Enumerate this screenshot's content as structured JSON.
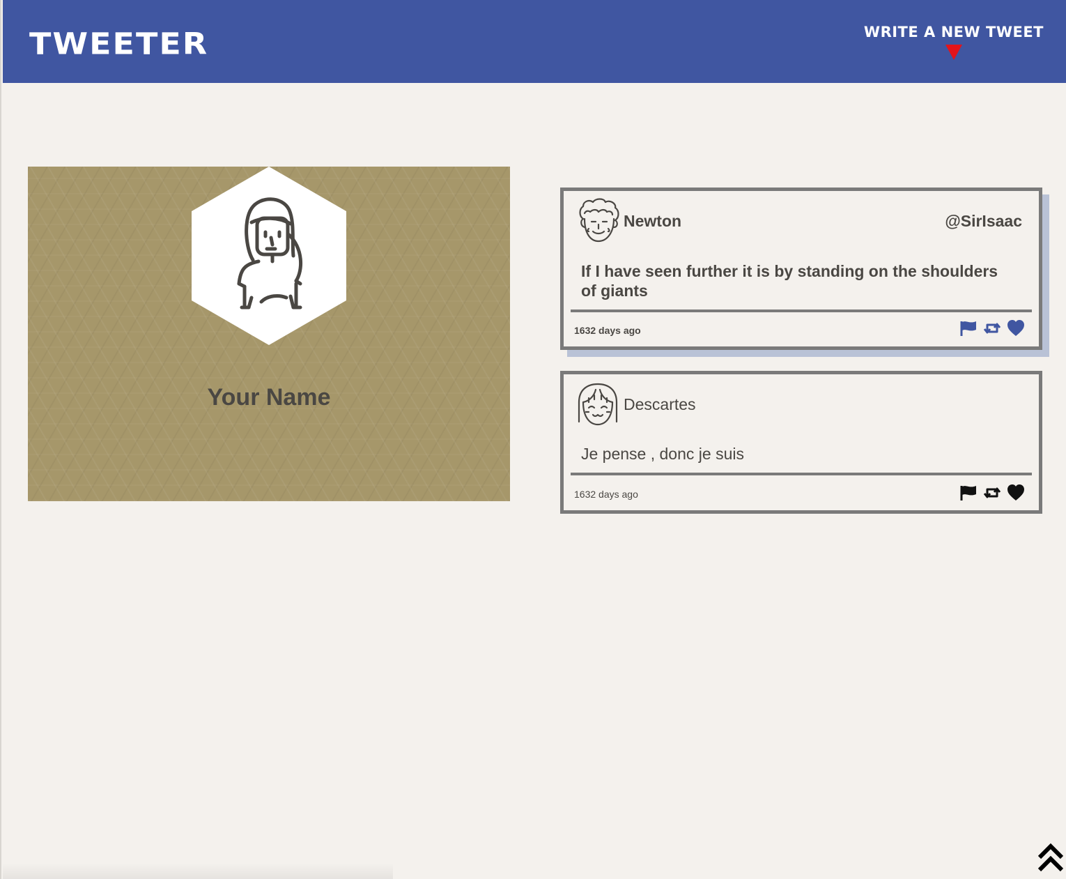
{
  "navbar": {
    "brand": "TWEETER",
    "compose_label": "WRITE A NEW TWEET",
    "background": "#4056a1",
    "arrow_color": "#e3141b"
  },
  "profile": {
    "name": "Your Name",
    "background": "#a6976a",
    "avatar_icon": "female-avatar-icon"
  },
  "tweets": [
    {
      "author": "Newton",
      "handle": "@SirIsaac",
      "content": "If I have seen further it is by standing on the shoulders of giants",
      "age": "1632 days ago",
      "avatar_icon": "curly-hair-avatar-icon",
      "action_color": "#4056a1",
      "hovered": true
    },
    {
      "author": "Descartes",
      "handle": "",
      "content": "Je pense , donc je suis",
      "age": "1632 days ago",
      "avatar_icon": "bob-hair-avatar-icon",
      "action_color": "#111111",
      "hovered": false
    }
  ],
  "actions": [
    "flag-icon",
    "retweet-icon",
    "heart-icon"
  ],
  "scroll_top_icon": "double-chevron-up-icon"
}
